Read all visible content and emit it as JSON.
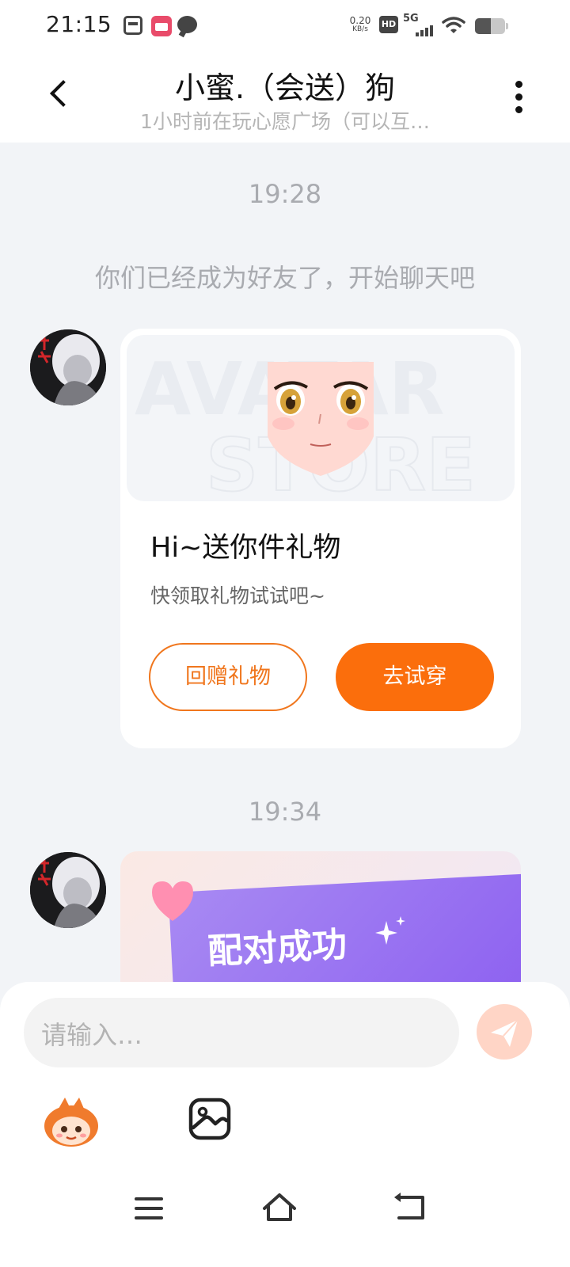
{
  "status_bar": {
    "time": "21:15",
    "network_speed_value": "0.20",
    "network_speed_unit": "KB/s",
    "hd_label": "HD",
    "network_type": "5G"
  },
  "header": {
    "title": "小蜜.（会送）狗",
    "subtitle": "1小时前在玩心愿广场（可以互…"
  },
  "chat": {
    "time_1": "19:28",
    "system_message": "你们已经成为好友了，开始聊天吧",
    "gift_card": {
      "banner_watermark_1": "AVATAR",
      "banner_watermark_2": "STORE",
      "title": "Hi~送你件礼物",
      "description": "快领取礼物试试吧~",
      "return_gift_label": "回赠礼物",
      "try_on_label": "去试穿"
    },
    "time_2": "19:34",
    "match_card": {
      "headline": "配对成功"
    }
  },
  "input": {
    "placeholder": "请输入…"
  },
  "colors": {
    "accent_orange": "#fb6e0c",
    "send_button_bg": "#ffd5c6",
    "chat_background": "#f2f4f7"
  },
  "icons": {
    "back": "chevron-left-icon",
    "more": "more-vertical-icon",
    "send": "paper-plane-icon",
    "emoji": "mascot-emoji-icon",
    "image": "image-icon",
    "nav_menu": "menu-icon",
    "nav_home": "home-icon",
    "nav_back": "back-icon"
  }
}
